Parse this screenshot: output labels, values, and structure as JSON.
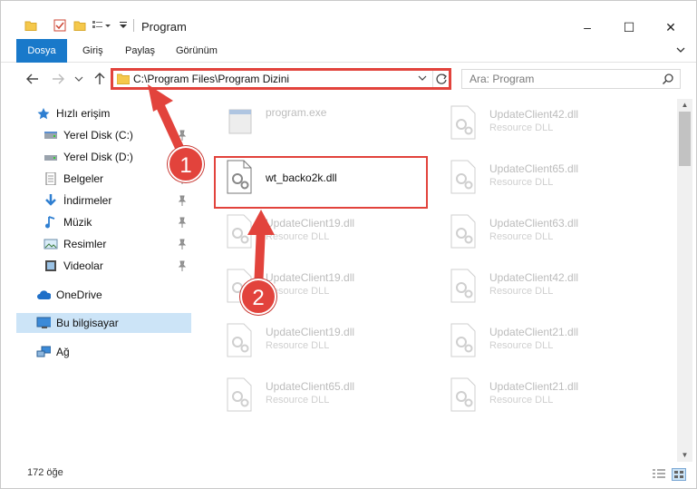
{
  "window": {
    "title": "Program",
    "controls": [
      "–",
      "☐",
      "✕"
    ]
  },
  "ribbon": {
    "tabs": [
      "Dosya",
      "Giriş",
      "Paylaş",
      "Görünüm"
    ]
  },
  "address": {
    "path": "C:\\Program Files\\Program Dizini",
    "search_placeholder": "Ara: Program"
  },
  "nav": {
    "items": [
      {
        "label": "Hızlı erişim",
        "icon": "star-icon"
      },
      {
        "label": "Yerel Disk (C:)",
        "icon": "drive-icon"
      },
      {
        "label": "Yerel Disk (D:)",
        "icon": "drive-icon"
      },
      {
        "label": "Belgeler",
        "icon": "documents-icon"
      },
      {
        "label": "İndirmeler",
        "icon": "downloads-icon"
      },
      {
        "label": "Müzik",
        "icon": "music-icon"
      },
      {
        "label": "Resimler",
        "icon": "pictures-icon"
      },
      {
        "label": "Videolar",
        "icon": "videos-icon"
      },
      {
        "label": "OneDrive",
        "icon": "cloud-icon"
      },
      {
        "label": "Bu bilgisayar",
        "icon": "computer-icon"
      },
      {
        "label": "Ağ",
        "icon": "network-icon"
      }
    ]
  },
  "files": [
    {
      "name": "program.exe",
      "type": ""
    },
    {
      "name": "UpdateClient42.dll",
      "type": "Resource DLL"
    },
    {
      "name": "wt_backo2k.dll",
      "type": ""
    },
    {
      "name": "UpdateClient65.dll",
      "type": "Resource DLL"
    },
    {
      "name": "UpdateClient19.dll",
      "type": "Resource DLL"
    },
    {
      "name": "UpdateClient63.dll",
      "type": "Resource DLL"
    },
    {
      "name": "UpdateClient19.dll",
      "type": "Resource DLL"
    },
    {
      "name": "UpdateClient42.dll",
      "type": "Resource DLL"
    },
    {
      "name": "UpdateClient19.dll",
      "type": "Resource DLL"
    },
    {
      "name": "UpdateClient21.dll",
      "type": "Resource DLL"
    },
    {
      "name": "UpdateClient65.dll",
      "type": "Resource DLL"
    },
    {
      "name": "UpdateClient21.dll",
      "type": "Resource DLL"
    }
  ],
  "status": {
    "count": "172 öğe"
  },
  "annotations": {
    "badge1": "1",
    "badge2": "2"
  },
  "colors": {
    "accent": "#1979ca",
    "highlight": "#e2433c",
    "selected": "#cce4f7"
  }
}
